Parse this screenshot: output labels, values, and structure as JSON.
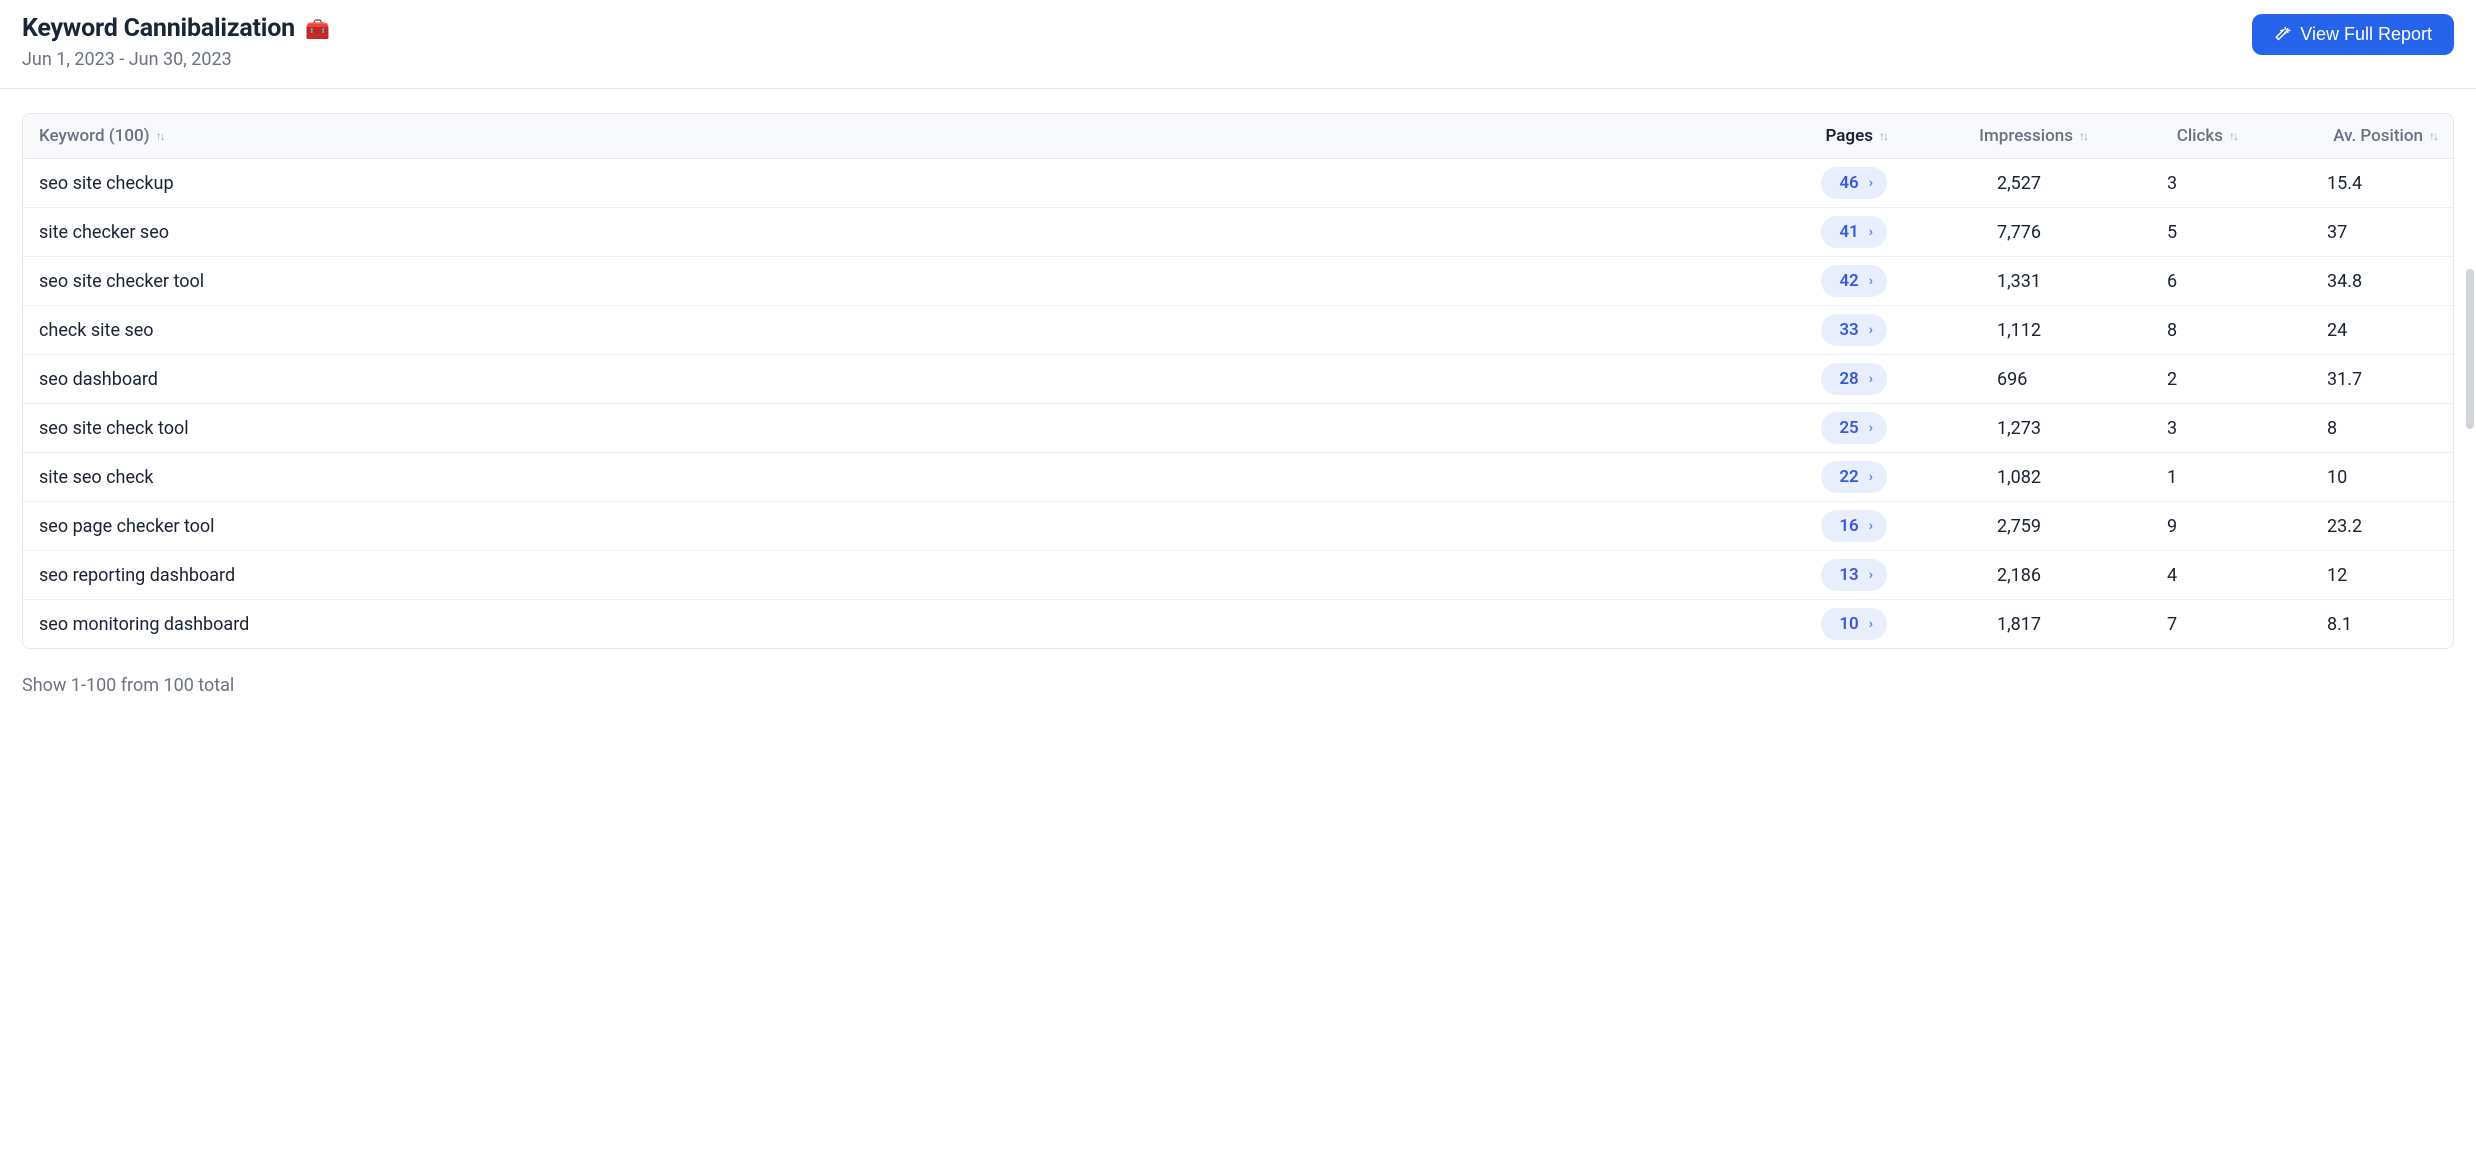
{
  "header": {
    "title": "Keyword Cannibalization",
    "title_icon": "🧰",
    "date_range": "Jun 1, 2023 - Jun 30, 2023",
    "view_report_label": "View Full Report"
  },
  "table": {
    "columns": {
      "keyword": "Keyword (100)",
      "pages": "Pages",
      "impressions": "Impressions",
      "clicks": "Clicks",
      "position": "Av. Position"
    },
    "rows": [
      {
        "keyword": "seo site checkup",
        "pages": "46",
        "impressions": "2,527",
        "clicks": "3",
        "position": "15.4"
      },
      {
        "keyword": "site checker seo",
        "pages": "41",
        "impressions": "7,776",
        "clicks": "5",
        "position": "37"
      },
      {
        "keyword": "seo site checker tool",
        "pages": "42",
        "impressions": "1,331",
        "clicks": "6",
        "position": "34.8"
      },
      {
        "keyword": "check site seo",
        "pages": "33",
        "impressions": "1,112",
        "clicks": "8",
        "position": "24"
      },
      {
        "keyword": "seo dashboard",
        "pages": "28",
        "impressions": "696",
        "clicks": "2",
        "position": "31.7"
      },
      {
        "keyword": "seo site check tool",
        "pages": "25",
        "impressions": "1,273",
        "clicks": "3",
        "position": "8"
      },
      {
        "keyword": "site seo check",
        "pages": "22",
        "impressions": "1,082",
        "clicks": "1",
        "position": "10"
      },
      {
        "keyword": "seo page checker tool",
        "pages": "16",
        "impressions": "2,759",
        "clicks": "9",
        "position": "23.2"
      },
      {
        "keyword": "seo reporting dashboard",
        "pages": "13",
        "impressions": "2,186",
        "clicks": "4",
        "position": "12"
      },
      {
        "keyword": "seo monitoring dashboard",
        "pages": "10",
        "impressions": "1,817",
        "clicks": "7",
        "position": "8.1"
      }
    ]
  },
  "footer": {
    "summary": "Show 1-100 from 100 total"
  }
}
